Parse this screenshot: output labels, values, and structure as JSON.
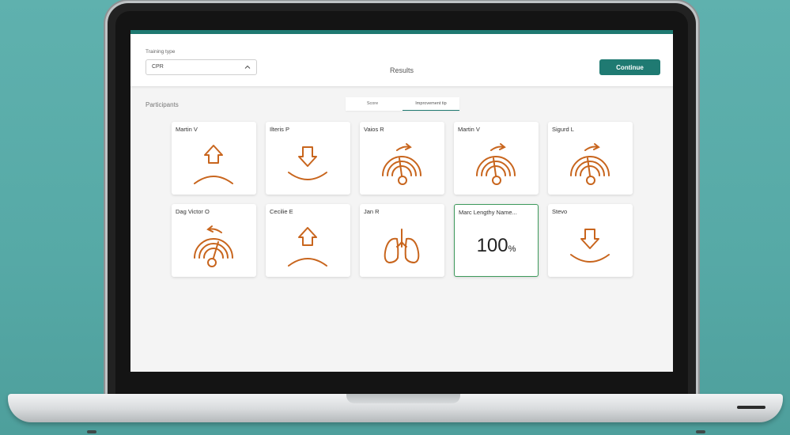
{
  "header": {
    "training_type_label": "Training type",
    "training_type_value": "CPR",
    "title": "Results",
    "continue_label": "Continue"
  },
  "participants_label": "Participants",
  "tabs": [
    {
      "label": "Score",
      "active": false
    },
    {
      "label": "Improvement tip",
      "active": true
    }
  ],
  "participants": [
    {
      "name": "Martin V",
      "icon": "chest-rise-up-arrow-icon"
    },
    {
      "name": "Ilteris P",
      "icon": "chest-compress-down-arrow-icon"
    },
    {
      "name": "Vaios R",
      "icon": "gauge-increase-icon"
    },
    {
      "name": "Martin V",
      "icon": "gauge-increase-icon"
    },
    {
      "name": "Sigurd L",
      "icon": "gauge-increase-icon"
    },
    {
      "name": "Dag Victor O",
      "icon": "gauge-decrease-icon"
    },
    {
      "name": "Cecilie E",
      "icon": "chest-rise-up-arrow-icon"
    },
    {
      "name": "Jan R",
      "icon": "lungs-icon"
    },
    {
      "name": "Marc Lengthy Name...",
      "score": "100",
      "unit": "%",
      "selected": true
    },
    {
      "name": "Stevo",
      "icon": "chest-compress-down-arrow-icon"
    }
  ],
  "colors": {
    "accent": "#1f7a72",
    "icon": "#c8651d",
    "selected_border": "#3e9a5c"
  }
}
